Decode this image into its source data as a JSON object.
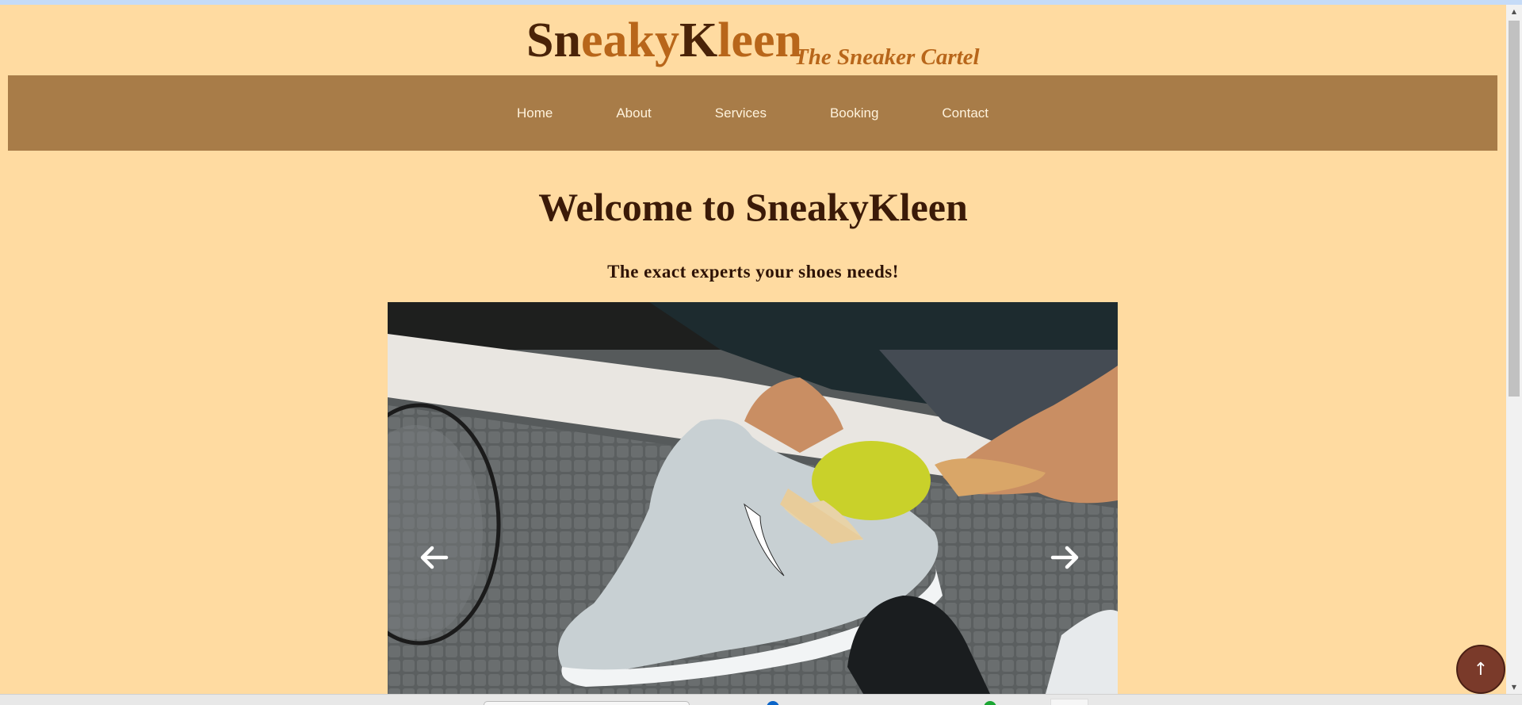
{
  "header": {
    "logo": {
      "part1": "Sn",
      "part2": "eaky",
      "part3": "K",
      "part4": "leen"
    },
    "tagline": "The Sneaker Cartel"
  },
  "nav": {
    "items": [
      {
        "label": "Home"
      },
      {
        "label": "About"
      },
      {
        "label": "Services"
      },
      {
        "label": "Booking"
      },
      {
        "label": "Contact"
      }
    ]
  },
  "main": {
    "title": "Welcome to SneakyKleen",
    "subtitle": "The exact experts your shoes needs!"
  },
  "slider": {
    "prev_icon": "arrow-left-icon",
    "next_icon": "arrow-right-icon"
  },
  "back_to_top": {
    "label": "↑"
  },
  "colors": {
    "page_bg": "#ffdba1",
    "nav_bg": "#a87c48",
    "logo_dark": "#4a2308",
    "logo_light": "#b8661a",
    "back_to_top_bg": "#7a3a2a"
  }
}
